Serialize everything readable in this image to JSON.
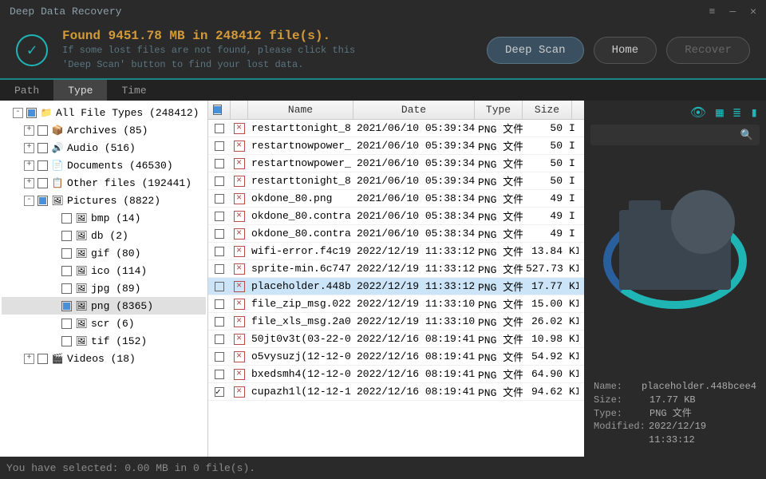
{
  "titlebar": {
    "title": "Deep Data Recovery"
  },
  "header": {
    "found": "Found 9451.78 MB in 248412 file(s).",
    "sub1": "If some lost files are not found, please click this",
    "sub2": "'Deep Scan' button to find your lost data.",
    "deepscan": "Deep Scan",
    "home": "Home",
    "recover": "Recover"
  },
  "tabs": {
    "path": "Path",
    "type": "Type",
    "time": "Time"
  },
  "tree": [
    {
      "ind": 1,
      "exp": "-",
      "cb": "partial",
      "icon": "📁",
      "label": "All File Types (248412)",
      "iconbg": "#4a90d9"
    },
    {
      "ind": 2,
      "exp": "+",
      "cb": "",
      "icon": "📦",
      "label": "Archives (85)"
    },
    {
      "ind": 2,
      "exp": "+",
      "cb": "",
      "icon": "🔊",
      "label": "Audio (516)",
      "iconbg": "#d9534f"
    },
    {
      "ind": 2,
      "exp": "+",
      "cb": "",
      "icon": "📄",
      "label": "Documents (46530)"
    },
    {
      "ind": 2,
      "exp": "+",
      "cb": "",
      "icon": "📋",
      "label": "Other files (192441)"
    },
    {
      "ind": 2,
      "exp": "-",
      "cb": "partial",
      "icon": "🖼",
      "label": "Pictures (8822)",
      "iconbg": "#5bc0de"
    },
    {
      "ind": 3,
      "exp": "",
      "cb": "",
      "icon": "🖼",
      "label": "bmp (14)"
    },
    {
      "ind": 3,
      "exp": "",
      "cb": "",
      "icon": "🖼",
      "label": "db (2)"
    },
    {
      "ind": 3,
      "exp": "",
      "cb": "",
      "icon": "🖼",
      "label": "gif (80)"
    },
    {
      "ind": 3,
      "exp": "",
      "cb": "",
      "icon": "🖼",
      "label": "ico (114)"
    },
    {
      "ind": 3,
      "exp": "",
      "cb": "",
      "icon": "🖼",
      "label": "jpg (89)"
    },
    {
      "ind": 3,
      "exp": "",
      "cb": "partial",
      "icon": "🖼",
      "label": "png (8365)",
      "sel": true
    },
    {
      "ind": 3,
      "exp": "",
      "cb": "",
      "icon": "🖼",
      "label": "scr (6)"
    },
    {
      "ind": 3,
      "exp": "",
      "cb": "",
      "icon": "🖼",
      "label": "tif (152)"
    },
    {
      "ind": 2,
      "exp": "+",
      "cb": "",
      "icon": "🎬",
      "label": "Videos (18)",
      "iconbg": "#5bc0de"
    }
  ],
  "fileHeaders": {
    "name": "Name",
    "date": "Date",
    "type": "Type",
    "size": "Size"
  },
  "files": [
    {
      "name": "restarttonight_8...",
      "date": "2021/06/10 05:39:34",
      "type": "PNG 文件",
      "size": "50",
      "unit": "I"
    },
    {
      "name": "restartnowpower_...",
      "date": "2021/06/10 05:39:34",
      "type": "PNG 文件",
      "size": "50",
      "unit": "I"
    },
    {
      "name": "restartnowpower_...",
      "date": "2021/06/10 05:39:34",
      "type": "PNG 文件",
      "size": "50",
      "unit": "I"
    },
    {
      "name": "restarttonight_8...",
      "date": "2021/06/10 05:39:34",
      "type": "PNG 文件",
      "size": "50",
      "unit": "I"
    },
    {
      "name": "okdone_80.png",
      "date": "2021/06/10 05:38:34",
      "type": "PNG 文件",
      "size": "49",
      "unit": "I"
    },
    {
      "name": "okdone_80.contra...",
      "date": "2021/06/10 05:38:34",
      "type": "PNG 文件",
      "size": "49",
      "unit": "I"
    },
    {
      "name": "okdone_80.contra...",
      "date": "2021/06/10 05:38:34",
      "type": "PNG 文件",
      "size": "49",
      "unit": "I"
    },
    {
      "name": "wifi-error.f4c19...",
      "date": "2022/12/19 11:33:12",
      "type": "PNG 文件",
      "size": "13.84",
      "unit": "KI"
    },
    {
      "name": "sprite-min.6c747...",
      "date": "2022/12/19 11:33:12",
      "type": "PNG 文件",
      "size": "527.73",
      "unit": "KI"
    },
    {
      "name": "placeholder.448b...",
      "date": "2022/12/19 11:33:12",
      "type": "PNG 文件",
      "size": "17.77",
      "unit": "KI",
      "sel": true
    },
    {
      "name": "file_zip_msg.022...",
      "date": "2022/12/19 11:33:10",
      "type": "PNG 文件",
      "size": "15.00",
      "unit": "KI"
    },
    {
      "name": "file_xls_msg.2a0...",
      "date": "2022/12/19 11:33:10",
      "type": "PNG 文件",
      "size": "26.02",
      "unit": "KI"
    },
    {
      "name": "50jt0v3t(03-22-0...",
      "date": "2022/12/16 08:19:41",
      "type": "PNG 文件",
      "size": "10.98",
      "unit": "KI"
    },
    {
      "name": "o5vysuzj(12-12-0...",
      "date": "2022/12/16 08:19:41",
      "type": "PNG 文件",
      "size": "54.92",
      "unit": "KI"
    },
    {
      "name": "bxedsmh4(12-12-0...",
      "date": "2022/12/16 08:19:41",
      "type": "PNG 文件",
      "size": "64.90",
      "unit": "KI"
    },
    {
      "name": "cupazh1l(12-12-1...",
      "date": "2022/12/16 08:19:41",
      "type": "PNG 文件",
      "size": "94.62",
      "unit": "KI",
      "chk": true
    }
  ],
  "preview": {
    "nameLabel": "Name:",
    "nameVal": "placeholder.448bcee4",
    "sizeLabel": "Size:",
    "sizeVal": "17.77 KB",
    "typeLabel": "Type:",
    "typeVal": "PNG 文件",
    "modLabel": "Modified:",
    "modVal": "2022/12/19 11:33:12"
  },
  "statusbar": "You have selected: 0.00 MB in 0 file(s)."
}
